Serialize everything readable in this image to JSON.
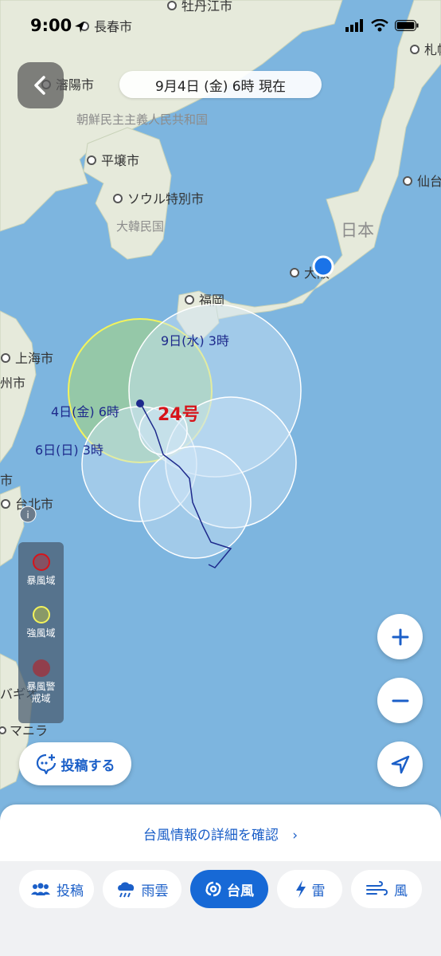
{
  "status": {
    "time": "9:00"
  },
  "header": {
    "date_label": "9月4日 (金) 6時 現在"
  },
  "map": {
    "place_labels": [
      "牡丹江市",
      "長春市",
      "瀋陽市",
      "札幌",
      "朝鮮民主主義人民共和国",
      "平壌市",
      "ソウル特別市",
      "大韓民国",
      "仙台",
      "日本",
      "大阪",
      "福岡",
      "上海市",
      "州市",
      "台北市",
      "市",
      "バギオ",
      "マニラ"
    ],
    "typhoon": {
      "name": "24号",
      "labels": [
        "9日(水) 3時",
        "4日(金) 6時",
        "6日(日) 3時"
      ]
    }
  },
  "legend": {
    "storm_zone": "暴風域",
    "strong_wind_zone": "強風域",
    "storm_warning_zone": "暴風警戒域"
  },
  "buttons": {
    "post": "投稿する"
  },
  "sheet": {
    "detail_link": "台風情報の詳細を確認"
  },
  "tabs": [
    {
      "label": "投稿",
      "icon": "people-icon"
    },
    {
      "label": "雨雲",
      "icon": "rain-cloud-icon"
    },
    {
      "label": "台風",
      "icon": "typhoon-icon"
    },
    {
      "label": "雷",
      "icon": "lightning-icon"
    },
    {
      "label": "風",
      "icon": "wind-icon"
    }
  ],
  "colors": {
    "accent": "#1769d6",
    "sea": "#7db5df",
    "land": "#e6eadb",
    "typhoon_label": "#d7141a",
    "strong_wind": "#f3f35c"
  }
}
